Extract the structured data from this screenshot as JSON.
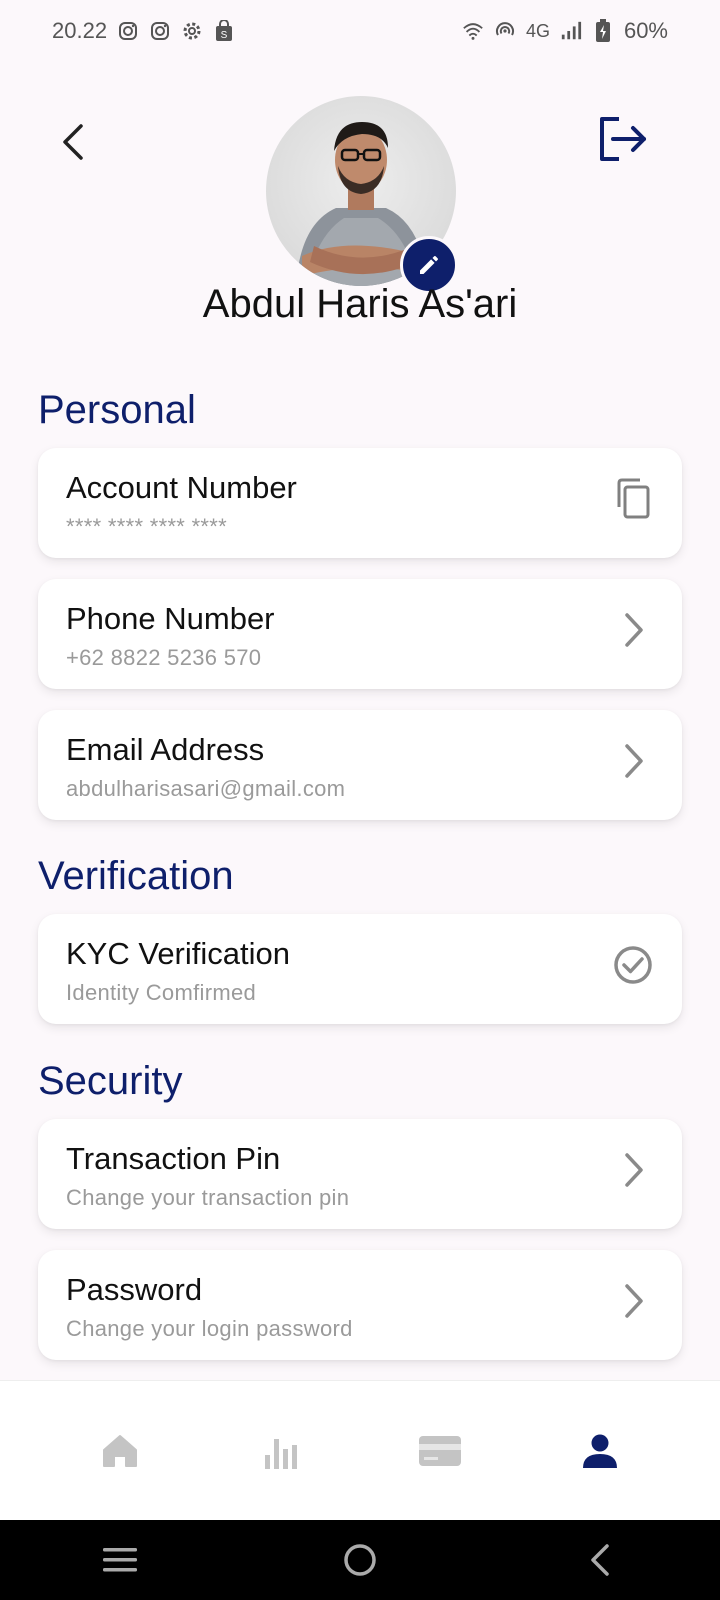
{
  "status_bar": {
    "time": "20.22",
    "network": "4G",
    "battery": "60%",
    "icons": [
      "instagram-icon",
      "instagram-icon",
      "settings-gear-icon",
      "shop-icon",
      "wifi-icon",
      "hotspot-icon",
      "signal-icon",
      "battery-charging-icon"
    ]
  },
  "header": {
    "name": "Abdul Haris As'ari",
    "back_icon": "chevron-left-icon",
    "logout_icon": "logout-icon",
    "edit_icon": "pencil-icon"
  },
  "sections": {
    "personal": {
      "title": "Personal",
      "items": [
        {
          "title": "Account Number",
          "subtitle": "**** **** **** ****",
          "action_icon": "copy-icon"
        },
        {
          "title": "Phone Number",
          "subtitle": "+62 8822 5236 570",
          "action_icon": "chevron-right-icon"
        },
        {
          "title": "Email Address",
          "subtitle": "abdulharisasari@gmail.com",
          "action_icon": "chevron-right-icon"
        }
      ]
    },
    "verification": {
      "title": "Verification",
      "items": [
        {
          "title": "KYC Verification",
          "subtitle": "Identity Comfirmed",
          "action_icon": "check-circle-icon"
        }
      ]
    },
    "security": {
      "title": "Security",
      "items": [
        {
          "title": "Transaction Pin",
          "subtitle": "Change your transaction pin",
          "action_icon": "chevron-right-icon"
        },
        {
          "title": "Password",
          "subtitle": "Change your login password",
          "action_icon": "chevron-right-icon"
        }
      ]
    }
  },
  "bottom_nav": {
    "items": [
      {
        "icon": "home-icon",
        "active": false
      },
      {
        "icon": "bar-chart-icon",
        "active": false
      },
      {
        "icon": "card-icon",
        "active": false
      },
      {
        "icon": "person-icon",
        "active": true
      }
    ]
  },
  "colors": {
    "accent": "#0e1f6b",
    "background": "#fcf8fb",
    "muted": "#9a9a9a",
    "inactive_nav": "#c4c4c4"
  }
}
